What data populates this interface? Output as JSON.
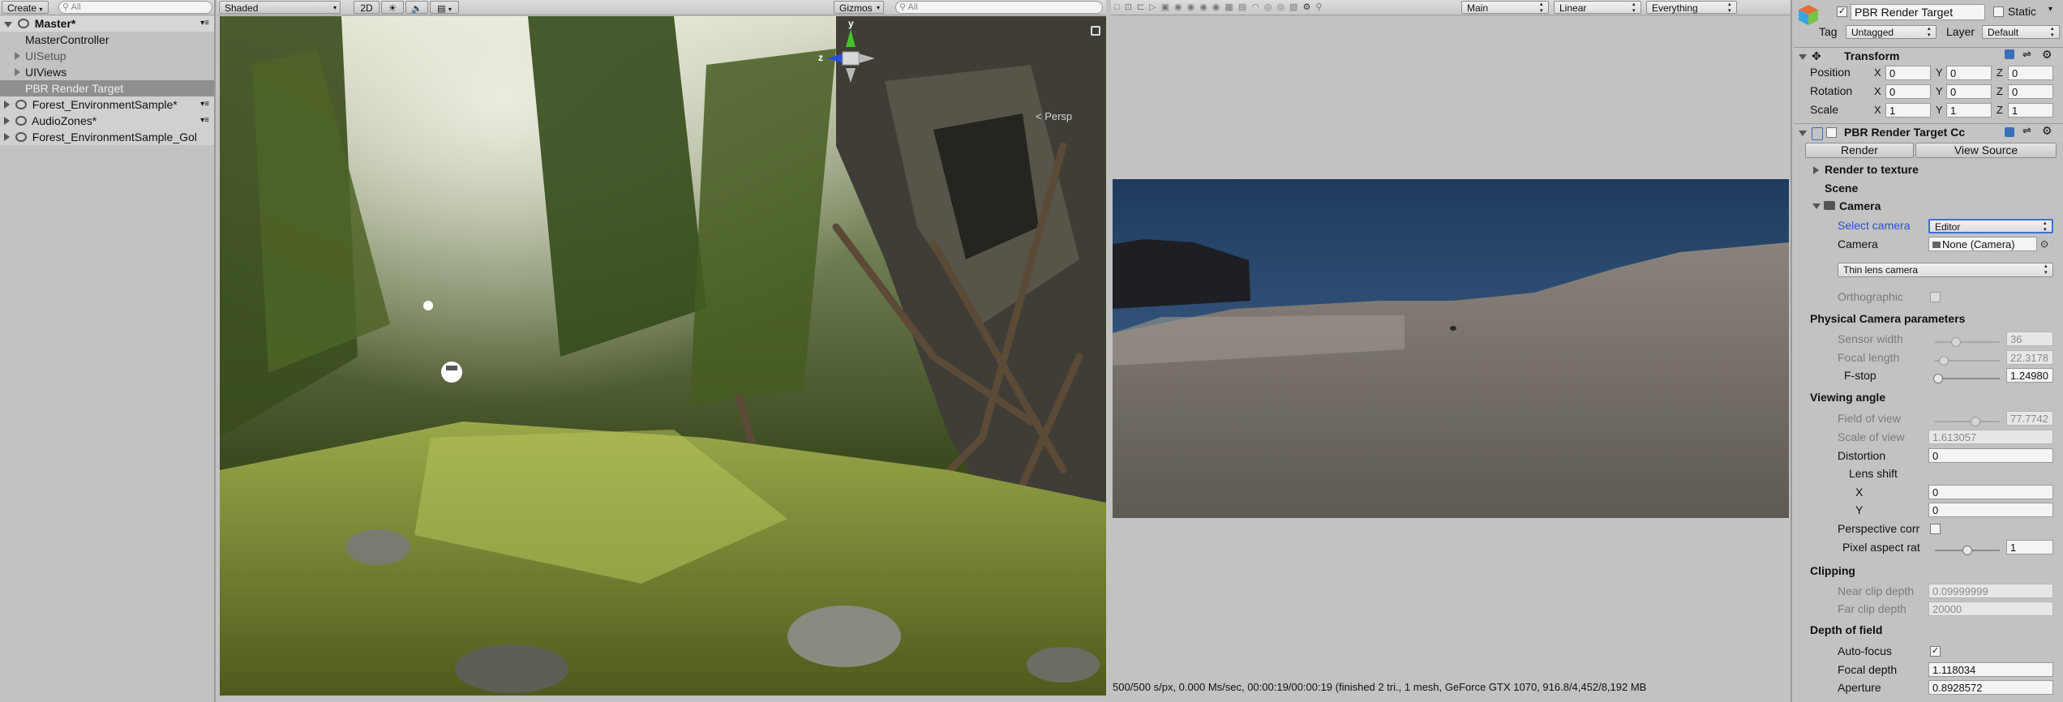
{
  "hierarchy": {
    "create_label": "Create",
    "search_placeholder": "All",
    "scene_name": "Master*",
    "items": [
      {
        "label": "MasterController"
      },
      {
        "label": "UISetup"
      },
      {
        "label": "UIViews"
      },
      {
        "label": "PBR Render Target"
      }
    ],
    "scenes": [
      {
        "label": "Forest_EnvironmentSample*"
      },
      {
        "label": "AudioZones*"
      },
      {
        "label": "Forest_EnvironmentSample_Gol"
      }
    ]
  },
  "scene_view": {
    "shading_mode": "Shaded",
    "mode_2d": "2D",
    "gizmos_label": "Gizmos",
    "search_placeholder": "All",
    "gizmo_axis_y": "y",
    "gizmo_axis_z": "z",
    "projection_label": "< Persp"
  },
  "render_view": {
    "dropdown_camera": "Main",
    "dropdown_color": "Linear",
    "dropdown_layers": "Everything",
    "status_text": "500/500 s/px, 0.000 Ms/sec, 00:00:19/00:00:19 (finished 2 tri., 1 mesh, GeForce GTX 1070, 916.8/4,452/8,192 MB"
  },
  "inspector": {
    "object_name": "PBR Render Target",
    "static_label": "Static",
    "tag_label": "Tag",
    "tag_value": "Untagged",
    "layer_label": "Layer",
    "layer_value": "Default",
    "transform": {
      "title": "Transform",
      "position_label": "Position",
      "rotation_label": "Rotation",
      "scale_label": "Scale",
      "position": {
        "x": "0",
        "y": "0",
        "z": "0"
      },
      "rotation": {
        "x": "0",
        "y": "0",
        "z": "0"
      },
      "scale": {
        "x": "1",
        "y": "1",
        "z": "1"
      }
    },
    "component": {
      "title": "PBR Render Target Cc",
      "render_button": "Render",
      "view_source_button": "View Source",
      "render_to_texture": "Render to texture",
      "scene_label": "Scene",
      "camera_section": "Camera",
      "select_camera_label": "Select camera",
      "select_camera_value": "Editor",
      "camera_label": "Camera",
      "camera_value": "None (Camera)",
      "lens_type": "Thin lens camera",
      "orthographic_label": "Orthographic",
      "physical_params": "Physical Camera parameters",
      "sensor_width_label": "Sensor width",
      "sensor_width": "36",
      "focal_length_label": "Focal length",
      "focal_length": "22.3178",
      "fstop_label": "F-stop",
      "fstop": "1.24980",
      "viewing_angle": "Viewing angle",
      "fov_label": "Field of view",
      "fov": "77.7742",
      "scale_of_view_label": "Scale of view",
      "scale_of_view": "1.613057",
      "distortion_label": "Distortion",
      "distortion": "0",
      "lens_shift_label": "Lens shift",
      "lens_shift_x_label": "X",
      "lens_shift_x": "0",
      "lens_shift_y_label": "Y",
      "lens_shift_y": "0",
      "perspective_label": "Perspective corr",
      "pixel_aspect_label": "Pixel aspect rat",
      "pixel_aspect": "1",
      "clipping": "Clipping",
      "near_clip_label": "Near clip depth",
      "near_clip": "0.09999999",
      "far_clip_label": "Far clip depth",
      "far_clip": "20000",
      "depth_of_field": "Depth of field",
      "autofocus_label": "Auto-focus",
      "focal_depth_label": "Focal depth",
      "focal_depth": "1.118034",
      "aperture_label": "Aperture",
      "aperture": "0.8928572"
    }
  },
  "colors": {
    "editor_bg": "#c2c2c2",
    "selection": "#8f8f8f",
    "link_blue": "#2b4fcf",
    "sky": "#2c4f78",
    "sand": "#7d7670"
  },
  "sliders": {
    "sensor_width": 0.32,
    "focal_length": 0.14,
    "fstop": 0.05,
    "fov": 0.62,
    "pixel_aspect": 0.5
  }
}
